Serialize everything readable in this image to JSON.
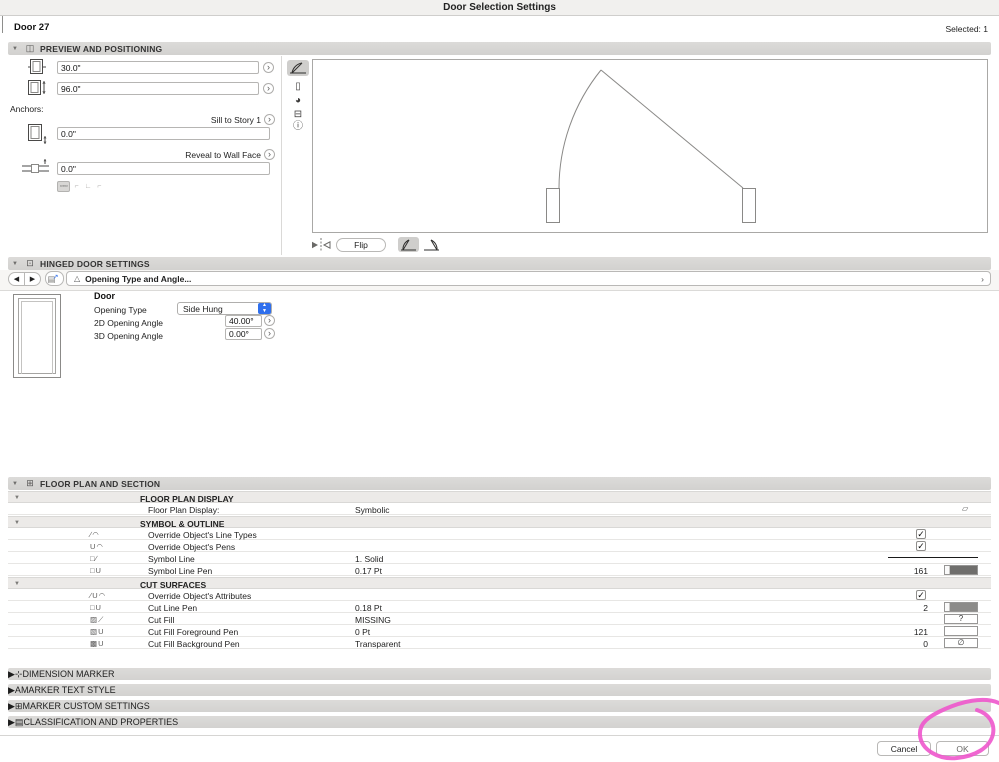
{
  "window": {
    "title": "Door Selection Settings"
  },
  "header": {
    "item_name": "Door 27",
    "selected_label": "Selected: 1"
  },
  "sections": {
    "preview": "PREVIEW AND POSITIONING",
    "hinged": "HINGED DOOR SETTINGS",
    "floor_plan": "FLOOR PLAN AND SECTION"
  },
  "preview": {
    "width_value": "30.0\"",
    "height_value": "96.0\"",
    "anchors_label": "Anchors:",
    "sill_anchor_label": "Sill to Story 1",
    "sill_value": "0.0\"",
    "reveal_anchor_label": "Reveal to Wall Face",
    "reveal_value": "0.0\"",
    "anchor_seg_glyphs": "▫◦▫",
    "anchor_loose_glyphs": "⌐ ∟ ⌐",
    "flip_label": "Flip"
  },
  "hinged": {
    "page_selector": "Opening Type and Angle...",
    "group_label": "Door",
    "opening_type_label": "Opening Type",
    "opening_type_value": "Side Hung",
    "angle2d_label": "2D Opening Angle",
    "angle2d_value": "40.00°",
    "angle3d_label": "3D Opening Angle",
    "angle3d_value": "0.00°"
  },
  "floor_plan": {
    "rows": [
      {
        "type": "subheader",
        "label": "FLOOR PLAN DISPLAY"
      },
      {
        "type": "item",
        "label": "Floor Plan Display:",
        "value": "Symbolic"
      },
      {
        "type": "subheader",
        "label": "SYMBOL & OUTLINE"
      },
      {
        "type": "item",
        "label": "Override Object's Line Types",
        "icon": "∕◠",
        "checked": "✓"
      },
      {
        "type": "item",
        "label": "Override Object's Pens",
        "icon": "U◠",
        "checked": "✓"
      },
      {
        "type": "item",
        "label": "Symbol Line",
        "icon": "□∕",
        "value": "1. Solid"
      },
      {
        "type": "item",
        "label": "Symbol Line Pen",
        "icon": "□U",
        "value": "0.17 Pt",
        "pen": "161"
      },
      {
        "type": "subheader",
        "label": "CUT SURFACES"
      },
      {
        "type": "item",
        "label": "Override Object's Attributes",
        "icon": "∕U◠",
        "checked": "✓"
      },
      {
        "type": "item",
        "label": "Cut Line Pen",
        "icon": "□U",
        "value": "0.18 Pt",
        "pen": "2"
      },
      {
        "type": "item",
        "label": "Cut Fill",
        "icon": "▨⟋",
        "value": "MISSING",
        "swatch": "?"
      },
      {
        "type": "item",
        "label": "Cut Fill Foreground Pen",
        "icon": "▧U",
        "value": "0 Pt",
        "pen": "121",
        "swatch": ""
      },
      {
        "type": "item",
        "label": "Cut Fill Background Pen",
        "icon": "▩U",
        "value": "Transparent",
        "pen": "0",
        "swatch": "∅"
      }
    ]
  },
  "collapsed_sections": [
    {
      "label": "DIMENSION MARKER",
      "icon": "⊹"
    },
    {
      "label": "MARKER TEXT STYLE",
      "icon": "A"
    },
    {
      "label": "MARKER CUSTOM SETTINGS",
      "icon": "⊞"
    },
    {
      "label": "CLASSIFICATION AND PROPERTIES",
      "icon": "▤"
    }
  ],
  "footer": {
    "cancel_label": "Cancel",
    "ok_label": "OK"
  },
  "icons": {
    "disclosure_open": "▼",
    "disclosure_closed": "▶",
    "chevron_more": "›",
    "back": "◀",
    "forward": "▶",
    "transfer_doc": "▤",
    "transfer_arrow": "↗",
    "angle": "△",
    "front_view": "▯",
    "three_d_view": "◕",
    "section_view": "⊟",
    "info": "ⓘ",
    "preview_section": "◫",
    "hinged_section": "⊡",
    "floor_plan_section": "⊞",
    "axon": "▱"
  },
  "colors": {
    "annotation_pink": "#ee57cc",
    "accent_blue": "#2f6fed",
    "header_gray": "#d6d5d3"
  }
}
